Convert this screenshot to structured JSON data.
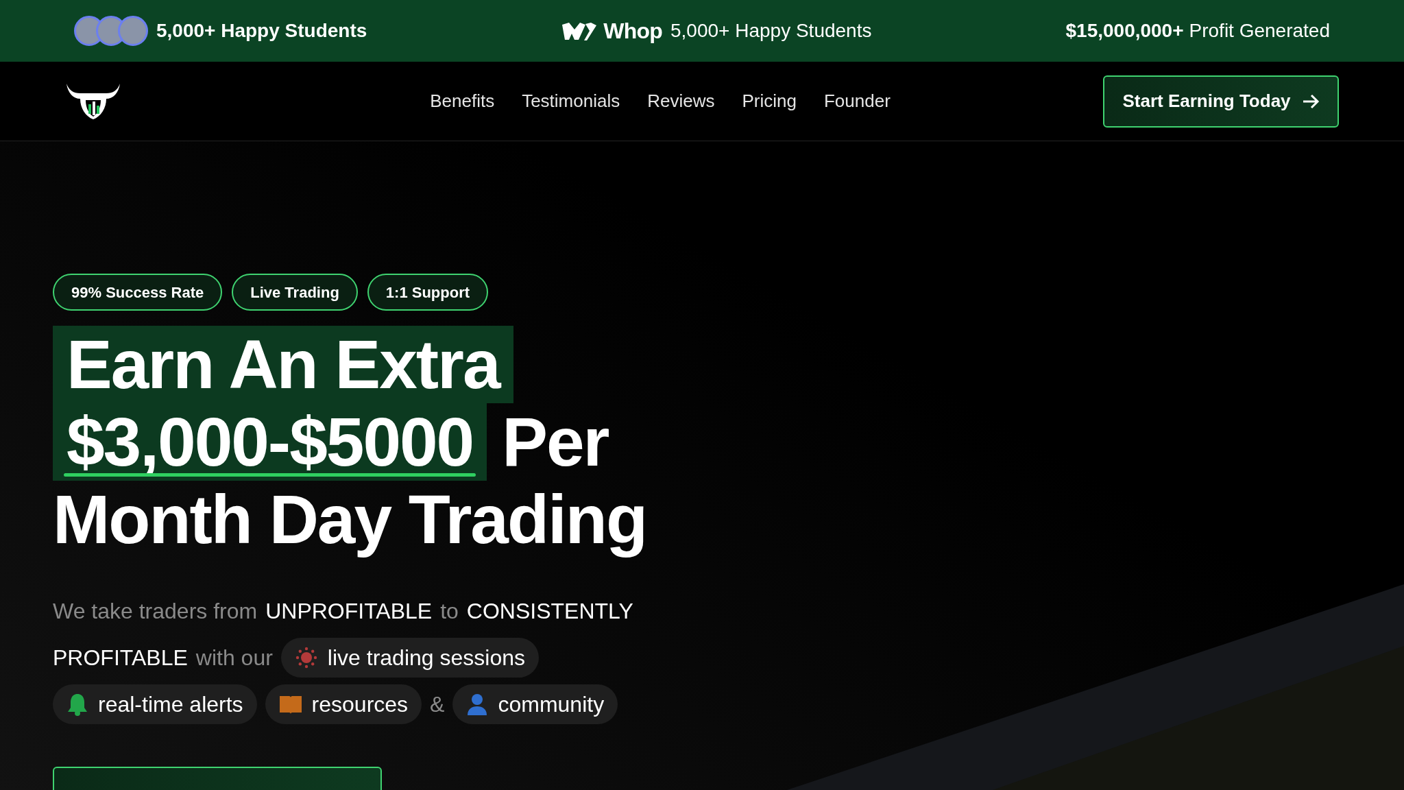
{
  "top_bar": {
    "students": {
      "text": "5,000+ Happy Students"
    },
    "whop": {
      "logo_text": "Whop",
      "text": "5,000+ Happy Students"
    },
    "profit": {
      "amount": "$15,000,000+",
      "text": "Profit Generated"
    }
  },
  "nav": {
    "links": [
      "Benefits",
      "Testimonials",
      "Reviews",
      "Pricing",
      "Founder"
    ],
    "cta": "Start Earning Today"
  },
  "hero": {
    "badges": [
      "99% Success Rate",
      "Live Trading",
      "1:1 Support"
    ],
    "headline": [
      [
        {
          "text": "Earn An Extra",
          "highlighted": true,
          "underlined": false
        }
      ],
      [
        {
          "text": "$3,000-$5000",
          "highlighted": true,
          "underlined": true
        },
        {
          "text": "Per",
          "highlighted": false,
          "underlined": false
        }
      ],
      [
        {
          "text": "Month Day Trading",
          "highlighted": false,
          "underlined": false
        }
      ]
    ],
    "description": [
      {
        "kind": "text",
        "text": "We take traders from",
        "emphasis": false
      },
      {
        "kind": "text",
        "text": "UNPROFITABLE",
        "emphasis": true
      },
      {
        "kind": "text",
        "text": "to",
        "emphasis": false
      },
      {
        "kind": "text",
        "text": "CONSISTENTLY",
        "emphasis": true
      },
      {
        "kind": "text",
        "text": "PROFITABLE",
        "emphasis": true
      },
      {
        "kind": "text",
        "text": "with our",
        "emphasis": false
      },
      {
        "kind": "pill",
        "text": "live trading sessions"
      },
      {
        "kind": "pill",
        "text": "real-time alerts"
      },
      {
        "kind": "pill",
        "text": "resources"
      },
      {
        "kind": "text",
        "text": "&",
        "emphasis": false
      },
      {
        "kind": "pill",
        "text": "community"
      }
    ]
  }
}
